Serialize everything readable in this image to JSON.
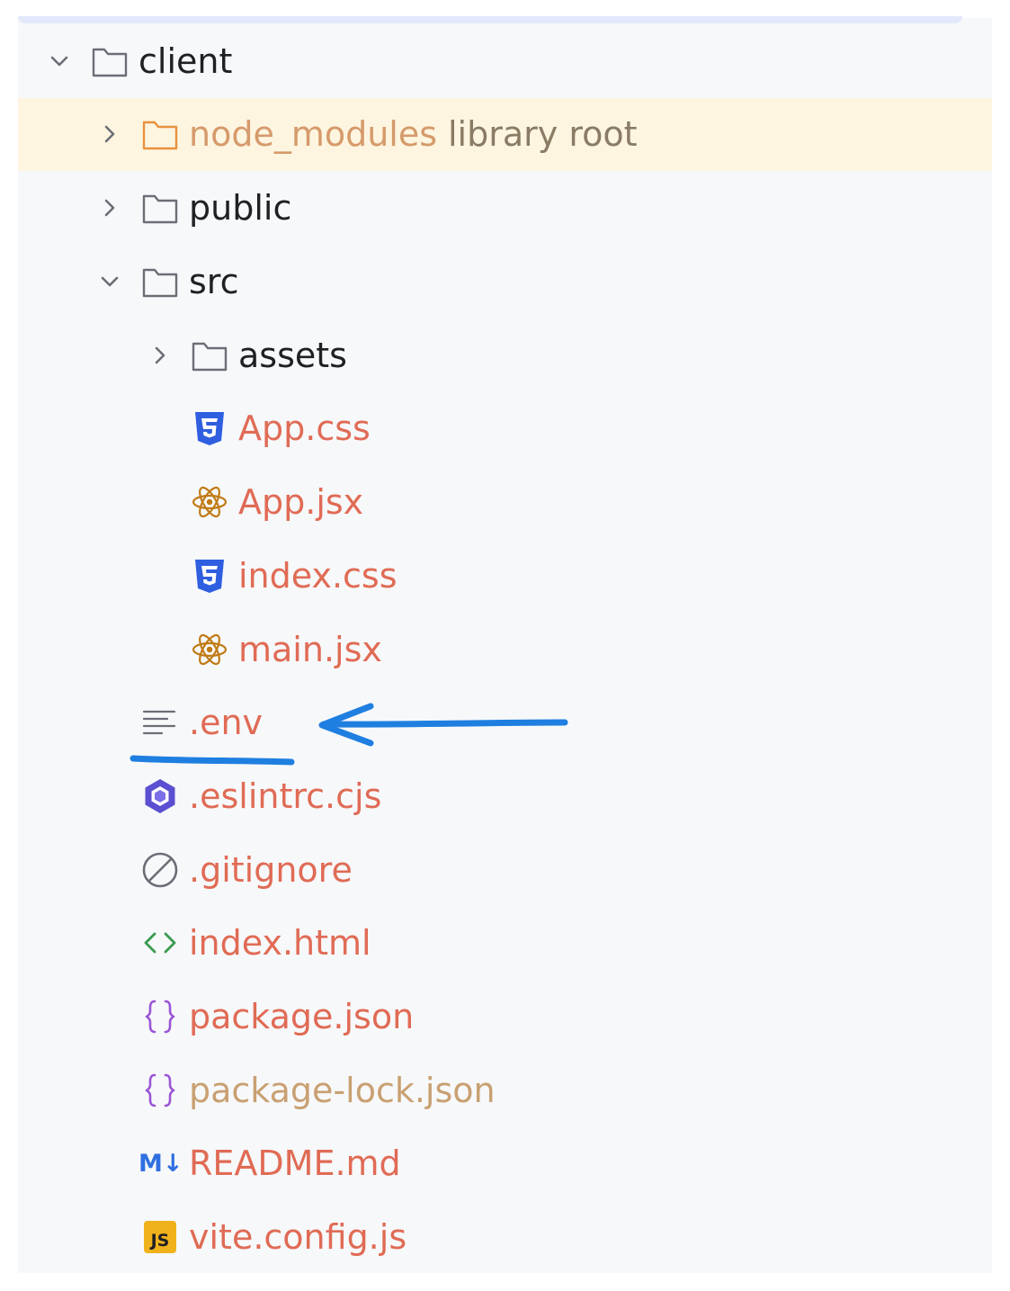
{
  "tree": {
    "root": {
      "label": "client",
      "expanded": true
    },
    "node_modules": {
      "label": "node_modules",
      "suffix": "library root",
      "expanded": false
    },
    "public": {
      "label": "public",
      "expanded": false
    },
    "src": {
      "label": "src",
      "expanded": true
    },
    "assets": {
      "label": "assets",
      "expanded": false
    },
    "app_css": {
      "label": "App.css",
      "icon": "css-icon"
    },
    "app_jsx": {
      "label": "App.jsx",
      "icon": "react-icon"
    },
    "index_css": {
      "label": "index.css",
      "icon": "css-icon"
    },
    "main_jsx": {
      "label": "main.jsx",
      "icon": "react-icon"
    },
    "env": {
      "label": ".env",
      "icon": "text-file-icon"
    },
    "eslintrc": {
      "label": ".eslintrc.cjs",
      "icon": "eslint-icon"
    },
    "gitignore": {
      "label": ".gitignore",
      "icon": "ignore-icon"
    },
    "index_html": {
      "label": "index.html",
      "icon": "html-icon"
    },
    "package_json": {
      "label": "package.json",
      "icon": "json-icon"
    },
    "package_lock": {
      "label": "package-lock.json",
      "icon": "json-icon"
    },
    "readme": {
      "label": "README.md",
      "icon": "markdown-icon",
      "icon_text": "M↓"
    },
    "vite_config": {
      "label": "vite.config.js",
      "icon": "js-icon",
      "icon_text": "JS"
    }
  },
  "colors": {
    "panel_bg": "#f7f8fa",
    "highlight_bg": "#fdf5e0",
    "modified_file": "#e06b55",
    "excluded_folder": "#d69a6b",
    "annotation_blue": "#1f7fe0"
  }
}
